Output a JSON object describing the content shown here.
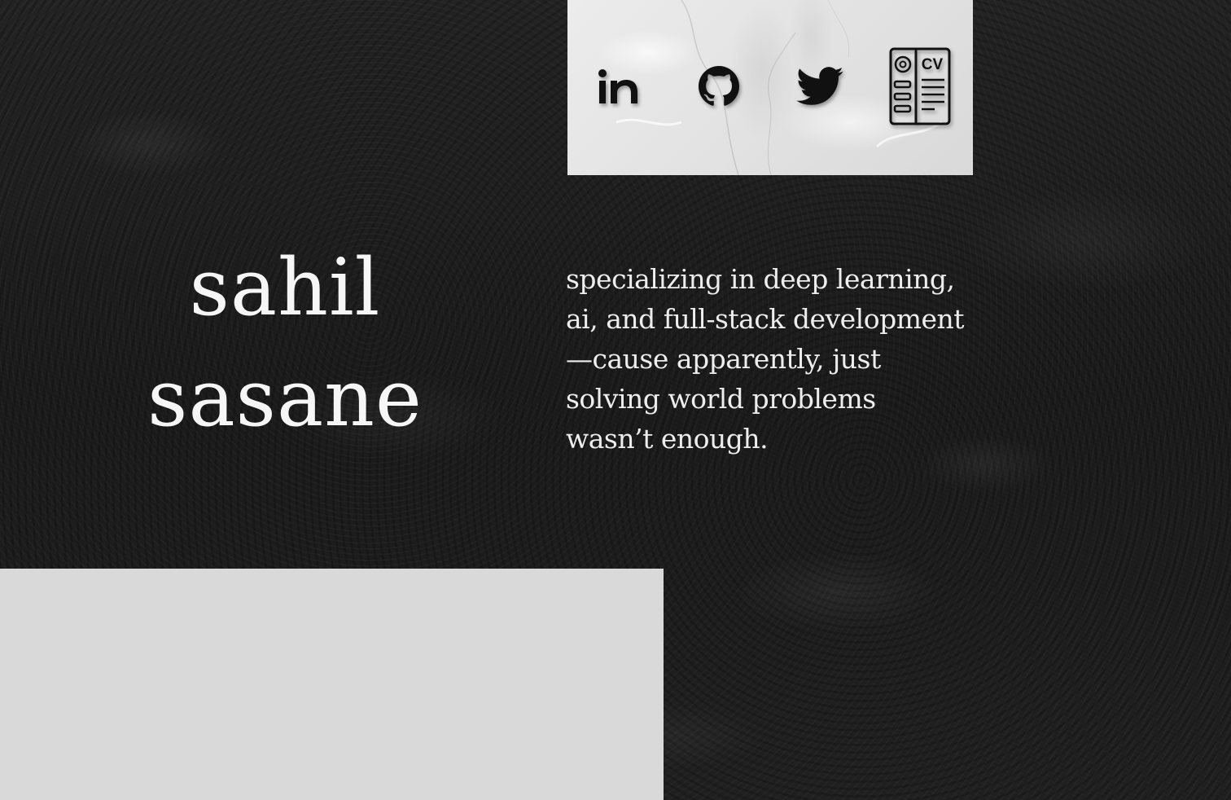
{
  "social": {
    "links": [
      {
        "name": "linkedin",
        "icon": "linkedin-icon",
        "label": "in"
      },
      {
        "name": "github",
        "icon": "github-icon"
      },
      {
        "name": "twitter",
        "icon": "twitter-icon"
      },
      {
        "name": "cv",
        "icon": "cv-document-icon",
        "label": "CV"
      }
    ],
    "panel_color": "#e4e4e4",
    "icon_color": "#111111"
  },
  "hero": {
    "name_first": "sahil",
    "name_last": "sasane",
    "tagline_lines": [
      "specializing in deep learning,",
      "ai, and full-stack development",
      "—cause apparently, just",
      "solving world problems",
      "wasn’t enough."
    ],
    "text_color": "#f6f6f6"
  },
  "placeholder": {
    "color": "#d9d9d9"
  },
  "background": {
    "color": "#1c1c1c"
  }
}
